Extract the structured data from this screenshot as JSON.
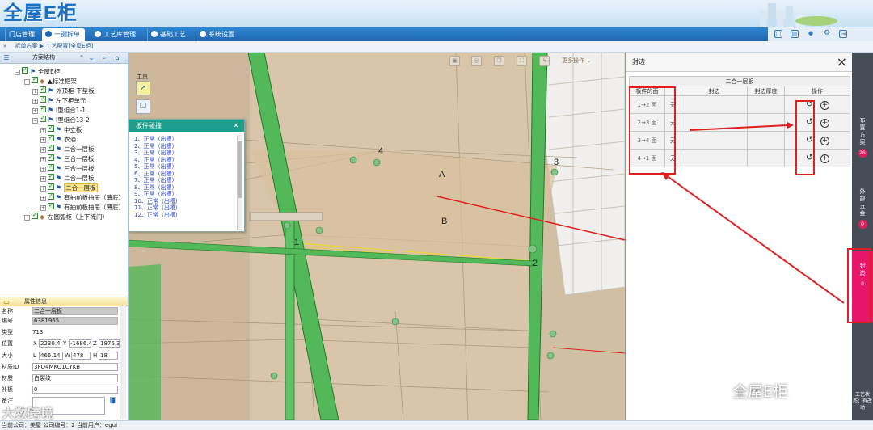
{
  "app": {
    "logo": "全屋E柜"
  },
  "nav": {
    "tabs": [
      {
        "label": "门店管理"
      },
      {
        "label": "一键拆单"
      },
      {
        "label": "工艺库管理"
      },
      {
        "label": "基础工艺"
      },
      {
        "label": "系统设置"
      }
    ]
  },
  "breadcrumb": {
    "text": "拆单方案 ▶ 工艺配置[全屋E柜]"
  },
  "tree": {
    "title": "方案结构",
    "nodes": [
      {
        "label": "全屋E柜"
      },
      {
        "label": "▲标准框架"
      },
      {
        "label": "外顶柜-下垫板"
      },
      {
        "label": "左下柜单元"
      },
      {
        "label": "I型组合1-1"
      },
      {
        "label": "I型组合13-2"
      },
      {
        "label": "中立板"
      },
      {
        "label": "衣通"
      },
      {
        "label": "二合一层板"
      },
      {
        "label": "三合一层板"
      },
      {
        "label": "三合一层板"
      },
      {
        "label": "二合一层板"
      },
      {
        "label": "二合一层板"
      },
      {
        "label": "有抽前板抽屉（薄底）"
      },
      {
        "label": "有抽前板抽屉（薄底）"
      },
      {
        "label": "左圆弧柜（上下掩门）"
      }
    ]
  },
  "props": {
    "title": "属性信息",
    "name_label": "名称",
    "name": "二合一层板",
    "code_label": "编号",
    "code": "6381965",
    "type_label": "类型",
    "type": "713",
    "pos_label": "位置",
    "x_label": "X",
    "x": "2230.4",
    "y_label": "Y",
    "y": "-1686.4",
    "z_label": "Z",
    "z": "1876.3",
    "size_label": "大小",
    "l_label": "L",
    "l": "466.14",
    "w_label": "W",
    "w": "478",
    "h_label": "H",
    "h": "18",
    "matid_label": "材质ID",
    "matid": "3FO4MKO1CYKB",
    "mat_label": "材质",
    "mat": "白裂纹",
    "patch_label": "补板",
    "patch": "0",
    "note_label": "备注",
    "note": ""
  },
  "status": {
    "text": "当前公司：美屋   公司编号：2    当前用户：egui"
  },
  "viewport": {
    "tool_label": "工具柜",
    "more": "更多操作",
    "labels": {
      "a": "A",
      "b": "B",
      "n1": "1",
      "n2": "2",
      "n3": "3",
      "n4": "4"
    }
  },
  "collision": {
    "title": "板件碰撞",
    "items": [
      "1、正常（出槽）",
      "2、正常（出槽）",
      "3、正常（出槽）",
      "4、正常（出槽）",
      "5、正常（出槽）",
      "6、正常（出槽）",
      "7、正常（出槽）",
      "8、正常（出槽）",
      "9、正常（出槽）",
      "10、正常（出槽）",
      "11、正常（出槽）",
      "12、正常（出槽）"
    ]
  },
  "edge": {
    "title": "封边",
    "caption": "二合一层板",
    "headers": [
      "板件的面",
      "",
      "封边",
      "封边厚度",
      "操作"
    ],
    "rows": [
      {
        "face": "1→2 面",
        "state": "无"
      },
      {
        "face": "2→3 面",
        "state": "无"
      },
      {
        "face": "3→4 面",
        "state": "无"
      },
      {
        "face": "4→1 面",
        "state": "无"
      }
    ]
  },
  "rbar": {
    "sections": [
      {
        "label": "布置方案",
        "count": "26"
      },
      {
        "label": "外部五金",
        "count": "0"
      },
      {
        "label": "封边",
        "count": "0"
      },
      {
        "label": "工艺状态：有改动",
        "count": ""
      }
    ]
  },
  "watermarks": {
    "left": "大数跨境",
    "right": "全屋E柜"
  },
  "colors": {
    "accent": "#1e67b3",
    "highlight": "#e8166b",
    "panel_green": "#3fb24b"
  }
}
